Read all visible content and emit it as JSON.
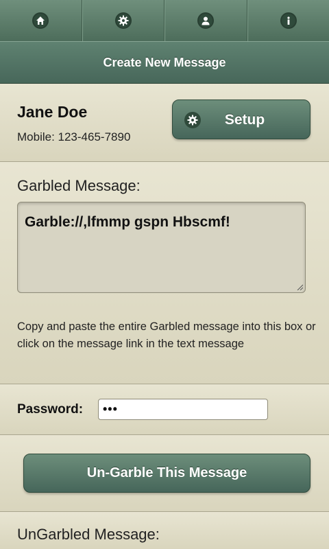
{
  "nav": {
    "tabs": [
      {
        "icon": "home-icon"
      },
      {
        "icon": "gear-icon"
      },
      {
        "icon": "user-icon"
      },
      {
        "icon": "info-icon"
      }
    ]
  },
  "header": {
    "title": "Create New Message"
  },
  "user": {
    "name": "Jane Doe",
    "mobile": "Mobile: 123-465-7890"
  },
  "setup_button": {
    "label": "Setup",
    "icon": "gear-icon"
  },
  "garbled": {
    "label": "Garbled Message:",
    "value": "Garble://,lfmmp gspn Hbscmf!",
    "hint": "Copy and paste the entire Garbled message into this box or click on the message link in the text message"
  },
  "password": {
    "label": "Password:",
    "value": "•••"
  },
  "ungarble_button": {
    "label": "Un-Garble This Message"
  },
  "result": {
    "label": "UnGarbled Message:"
  },
  "colors": {
    "bar_green": "#4d6d5b",
    "background": "#e4e1cc",
    "button_green": "#46665a"
  }
}
